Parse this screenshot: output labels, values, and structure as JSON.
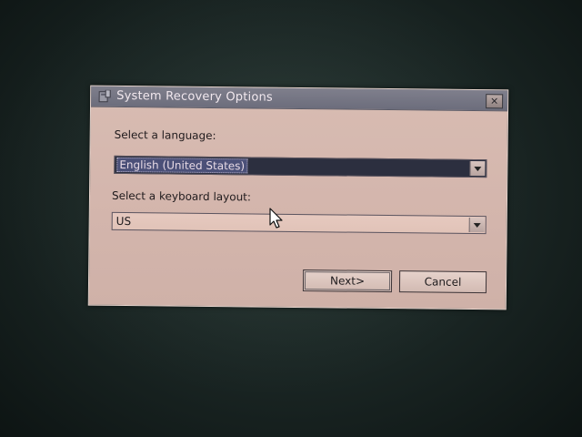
{
  "window": {
    "title": "System Recovery Options",
    "close_glyph": "×",
    "icon": "recovery-window-icon"
  },
  "language": {
    "label": "Select a language:",
    "selected": "English (United States)"
  },
  "keyboard": {
    "label": "Select a keyboard layout:",
    "selected": "US"
  },
  "buttons": {
    "next": "Next>",
    "cancel": "Cancel"
  },
  "colors": {
    "dialog_bg": "#d4b6ad",
    "title_bar": "#6c6d7c",
    "selection": "#2c2f3f"
  }
}
